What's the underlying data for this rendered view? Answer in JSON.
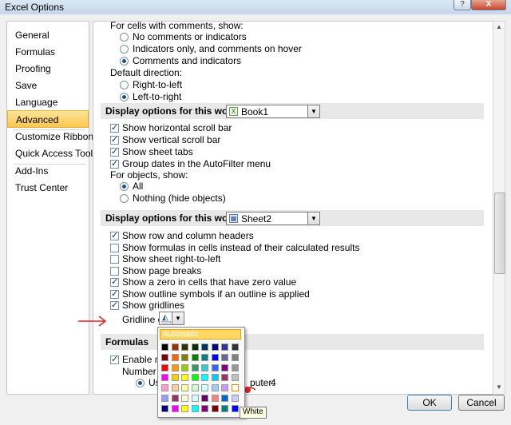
{
  "window": {
    "title": "Excel Options",
    "help_label": "?",
    "close_label": "X"
  },
  "nav": {
    "items": [
      "General",
      "Formulas",
      "Proofing",
      "Save",
      "Language",
      "Advanced",
      "Customize Ribbon",
      "Quick Access Toolbar",
      "Add-Ins",
      "Trust Center"
    ],
    "selected": "Advanced"
  },
  "comments": {
    "heading": "For cells with comments, show:",
    "options": [
      "No comments or indicators",
      "Indicators only, and comments on hover",
      "Comments and indicators"
    ],
    "selected_index": 2
  },
  "direction": {
    "heading": "Default direction:",
    "options": [
      "Right-to-left",
      "Left-to-right"
    ],
    "selected_index": 1
  },
  "workbook": {
    "header": "Display options for this workbook:",
    "combo_value": "Book1",
    "checks": [
      {
        "label": "Show horizontal scroll bar",
        "checked": true
      },
      {
        "label": "Show vertical scroll bar",
        "checked": true
      },
      {
        "label": "Show sheet tabs",
        "checked": true
      },
      {
        "label": "Group dates in the AutoFilter menu",
        "checked": true
      }
    ],
    "objects_heading": "For objects, show:",
    "object_options": [
      "All",
      "Nothing (hide objects)"
    ],
    "object_selected_index": 0
  },
  "worksheet": {
    "header": "Display options for this worksheet:",
    "combo_value": "Sheet2",
    "checks": [
      {
        "label": "Show row and column headers",
        "checked": true
      },
      {
        "label": "Show formulas in cells instead of their calculated results",
        "checked": false
      },
      {
        "label": "Show sheet right-to-left",
        "checked": false
      },
      {
        "label": "Show page breaks",
        "checked": false
      },
      {
        "label": "Show a zero in cells that have zero value",
        "checked": true
      },
      {
        "label": "Show outline symbols if an outline is applied",
        "checked": true
      },
      {
        "label": "Show gridlines",
        "checked": true
      }
    ],
    "gridline_label": "Gridline color"
  },
  "formulas": {
    "header": "Formulas",
    "enable_label": "Enable mult",
    "number_label": "Number of c",
    "use_label": "Us",
    "computer_label": "puter:",
    "computer_value": "4"
  },
  "color_popup": {
    "automatic_label": "Automatic",
    "tooltip": "White",
    "colors": [
      [
        "#000000",
        "#993300",
        "#333300",
        "#003300",
        "#003366",
        "#000080",
        "#333399",
        "#333333"
      ],
      [
        "#800000",
        "#ff6600",
        "#808000",
        "#008000",
        "#008080",
        "#0000ff",
        "#666699",
        "#808080"
      ],
      [
        "#ff0000",
        "#ff9900",
        "#99cc00",
        "#339966",
        "#33cccc",
        "#3366ff",
        "#800080",
        "#969696"
      ],
      [
        "#ff00ff",
        "#ffcc00",
        "#ffff00",
        "#00ff00",
        "#00ffff",
        "#00ccff",
        "#993366",
        "#c0c0c0"
      ],
      [
        "#ff99cc",
        "#ffcc99",
        "#ffff99",
        "#ccffcc",
        "#ccffff",
        "#99ccff",
        "#cc99ff",
        "#ffffff"
      ],
      [
        "#9999ff",
        "#993366",
        "#ffffcc",
        "#ccffff",
        "#660066",
        "#ff8080",
        "#0066cc",
        "#ccccff"
      ],
      [
        "#000080",
        "#ff00ff",
        "#ffff00",
        "#00ffff",
        "#800080",
        "#800000",
        "#008080",
        "#0000ff"
      ]
    ]
  },
  "buttons": {
    "ok": "OK",
    "cancel": "Cancel"
  }
}
